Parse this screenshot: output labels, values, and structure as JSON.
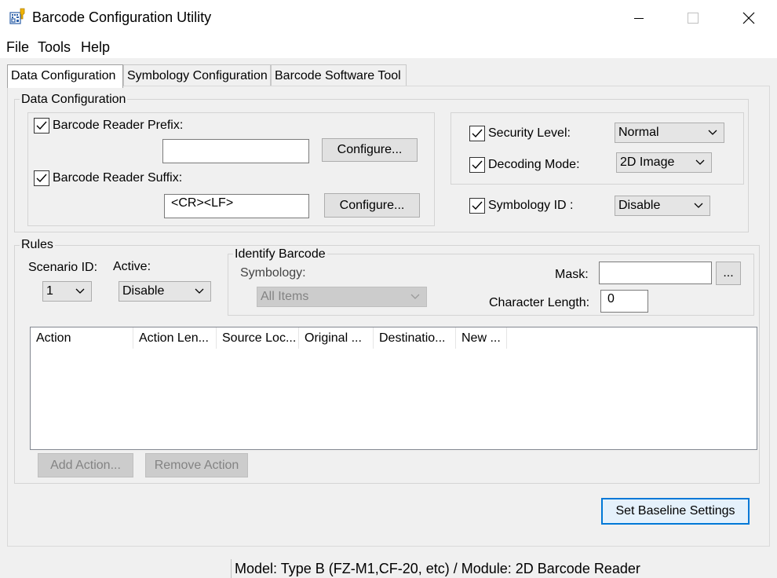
{
  "window": {
    "title": "Barcode Configuration Utility",
    "icon": "barcode-app-icon",
    "controls": [
      "minimize-icon",
      "maximize-icon",
      "close-icon"
    ]
  },
  "menu": {
    "file": "File",
    "tools": "Tools",
    "help": "Help"
  },
  "tabs": [
    {
      "label": "Data Configuration",
      "active": true
    },
    {
      "label": "Symbology Configuration",
      "active": false
    },
    {
      "label": "Barcode Software Tool",
      "active": false
    }
  ],
  "data_config": {
    "group_label": "Data Configuration",
    "prefix": {
      "label": "Barcode Reader Prefix:",
      "checked": true,
      "value": "",
      "button": "Configure..."
    },
    "suffix": {
      "label": "Barcode Reader Suffix:",
      "checked": true,
      "value": "<CR><LF>",
      "button": "Configure..."
    },
    "security_level": {
      "label": "Security Level:",
      "checked": true,
      "value": "Normal"
    },
    "decoding_mode": {
      "label": "Decoding Mode:",
      "checked": true,
      "value": "2D Image"
    },
    "symbology_id": {
      "label": "Symbology ID :",
      "checked": true,
      "value": "Disable"
    }
  },
  "rules": {
    "group_label": "Rules",
    "scenario_id": {
      "label": "Scenario ID:",
      "value": "1"
    },
    "active": {
      "label": "Active:",
      "value": "Disable"
    },
    "identify": {
      "group_label": "Identify Barcode",
      "symbology_label": "Symbology:",
      "symbology_value": "All Items",
      "mask_label": "Mask:",
      "mask_value": "",
      "mask_button": "...",
      "char_length_label": "Character Length:",
      "char_length_value": "0"
    },
    "table": {
      "columns": [
        "Action",
        "Action Len...",
        "Source Loc...",
        "Original ...",
        "Destinatio...",
        "New ..."
      ],
      "rows": []
    },
    "add_action": "Add Action...",
    "remove_action": "Remove Action"
  },
  "baseline_button": "Set Baseline Settings",
  "status": {
    "text": "Model: Type B (FZ-M1,CF-20, etc) / Module: 2D Barcode Reader"
  },
  "colors": {
    "accent": "#0078d7",
    "window_bg": "#f0f0f0",
    "disabled_text": "#838383"
  }
}
